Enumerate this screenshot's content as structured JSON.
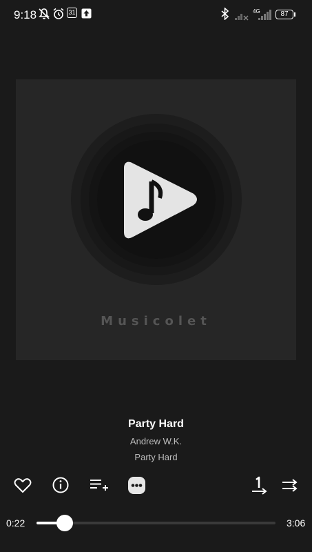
{
  "status_bar": {
    "time": "9:18",
    "calendar_day": "31",
    "network": "4G",
    "battery": "87",
    "icons": [
      "bell-off-icon",
      "alarm-icon",
      "calendar-icon",
      "upload-icon",
      "bluetooth-icon",
      "signal-icon",
      "battery-icon"
    ]
  },
  "artwork": {
    "brand": "Musicolet"
  },
  "track": {
    "title": "Party Hard",
    "artist": "Andrew W.K.",
    "album": "Party Hard"
  },
  "controls": {
    "left": [
      "heart-icon",
      "info-icon",
      "add-to-queue-icon",
      "more-icon"
    ],
    "right": [
      "repeat-one-icon",
      "shuffle-icon"
    ]
  },
  "progress": {
    "elapsed": "0:22",
    "duration": "3:06",
    "fraction": 0.118
  },
  "colors": {
    "background": "#1a1a1a",
    "artwork_bg": "#262626",
    "accent": "#ffffff"
  }
}
